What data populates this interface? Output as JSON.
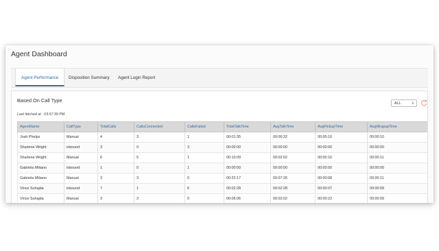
{
  "page": {
    "title": "Agent Dashboard"
  },
  "tabs": [
    {
      "label": "Agent Performance",
      "active": true
    },
    {
      "label": "Disposition Summary",
      "active": false
    },
    {
      "label": "Agent Login Report",
      "active": false
    }
  ],
  "panel": {
    "title": "Based On Call Type",
    "filter": {
      "selected": "ALL"
    },
    "refresh_icon": "refresh-icon",
    "last_fetched": "Last fetched at : 03:57:39 PM"
  },
  "table": {
    "columns": [
      "AgentName",
      "CallType",
      "TotalCalls",
      "CallsConnected",
      "CallsFailed",
      "TotalTalkTime",
      "AvgTalkTime",
      "AvgPickupTime",
      "AvgWrapupTime"
    ],
    "rows": [
      [
        "Josh Phelps",
        "Manual",
        "4",
        "3",
        "1",
        "00:01:35",
        "00:00:32",
        "00:00:10",
        "00:00:10"
      ],
      [
        "Sharlene Wright",
        "inbound",
        "3",
        "0",
        "3",
        "00:00:00",
        "00:00:00",
        "00:00:00",
        "00:00:00"
      ],
      [
        "Sharlene Wright",
        "Manual",
        "6",
        "5",
        "1",
        "00:10:09",
        "00:02:02",
        "00:00:16",
        "00:00:11"
      ],
      [
        "Gabriela Miliano",
        "inbound",
        "1",
        "0",
        "1",
        "00:00:00",
        "00:00:00",
        "00:00:00",
        "00:00:00"
      ],
      [
        "Gabriela Miliano",
        "Manual",
        "3",
        "3",
        "0",
        "00:22:17",
        "00:07:26",
        "00:00:08",
        "00:00:11"
      ],
      [
        "Vince Suhajda",
        "inbound",
        "7",
        "1",
        "6",
        "00:02:28",
        "00:02:28",
        "00:00:07",
        "00:00:09"
      ],
      [
        "Vince Suhajda",
        "Manual",
        "3",
        "3",
        "0",
        "00:06:06",
        "00:02:02",
        "00:00:22",
        "00:00:09"
      ]
    ]
  },
  "colors": {
    "accent": "#2e6da4",
    "refresh": "#d9534f"
  }
}
